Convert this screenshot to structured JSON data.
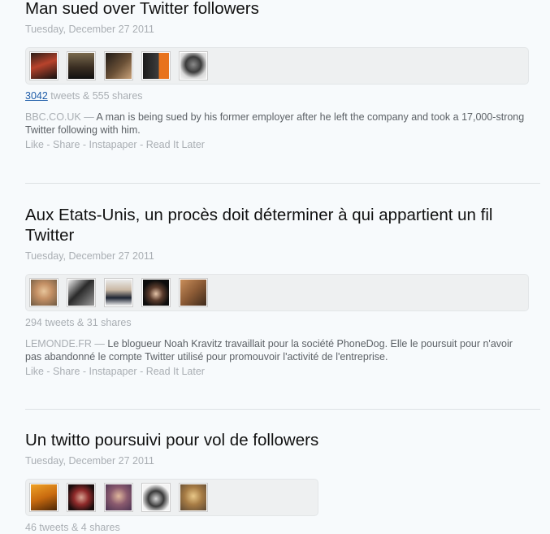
{
  "stories": [
    {
      "headline": "Man sued over Twitter followers",
      "date": "Tuesday, December 27 2011",
      "tweets_count": "3042",
      "tweets_suffix": " tweets & 555 shares",
      "stats_text": "",
      "source": "BBC.CO.UK",
      "dash": " — ",
      "summary": "A man is being sued by his former employer after he left the company and took a 17,000-strong Twitter following with him.",
      "actions": [
        "Like",
        "Share",
        "Instapaper",
        "Read It Later"
      ],
      "avatars": [
        "avatar-person-sunglasses-red",
        "avatar-person-dark",
        "avatar-person-hat",
        "avatar-person-orange-sign",
        "avatar-person-woman-bw"
      ]
    },
    {
      "headline": "Aux Etats-Unis, un procès doit déterminer à qui appartient un fil Twitter",
      "date": "Tuesday, December 27 2011",
      "tweets_count": "",
      "tweets_suffix": "",
      "stats_text": "294 tweets & 31 shares",
      "source": "LEMONDE.FR",
      "dash": " — ",
      "summary": "Le blogueur Noah Kravitz travaillait pour la société PhoneDog. Elle le poursuit pour n'avoir pas abandonné le compte Twitter utilisé pour promouvoir l'activité de l'entreprise.",
      "actions": [
        "Like",
        "Share",
        "Instapaper",
        "Read It Later"
      ],
      "avatars": [
        "avatar-man-blond",
        "avatar-bw-figure",
        "avatar-man-suit",
        "avatar-woman-dark-hair",
        "avatar-man-sepia"
      ]
    },
    {
      "headline": "Un twitto poursuivi pour vol de followers",
      "date": "Tuesday, December 27 2011",
      "tweets_count": "",
      "tweets_suffix": "",
      "stats_text": "46 tweets & 4 shares",
      "source": "",
      "dash": "",
      "summary": "",
      "actions": [],
      "avatars": [
        "avatar-orange-light",
        "avatar-woman-red",
        "avatar-woman-purple",
        "avatar-woman-bw-hair",
        "avatar-woman-blonde"
      ]
    }
  ],
  "separator": " - "
}
